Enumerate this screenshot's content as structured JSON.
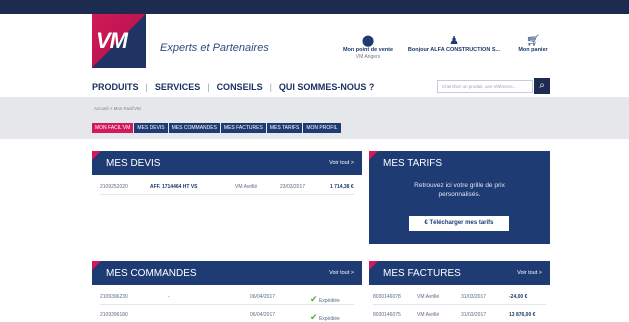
{
  "header": {
    "logo_text": "VM",
    "tagline": "Experts et Partenaires",
    "store_label": "Mon point de vente",
    "store_name": "VM Angers",
    "greeting": "Bonjour ALFA CONSTRUCTION S...",
    "cart_label": "Mon panier"
  },
  "nav": {
    "items": [
      "PRODUITS",
      "SERVICES",
      "CONSEILS",
      "QUI SOMMES-NOUS ?"
    ],
    "search_placeholder": "Cherchez un produit, une référence..."
  },
  "breadcrumb": "Accueil > Mon Facil'VM",
  "tabs": [
    "MON FACIL'VM",
    "MES DEVIS",
    "MES COMMANDES",
    "MES FACTURES",
    "MES TARIFS",
    "MON PROFIL"
  ],
  "devis": {
    "title": "MES DEVIS",
    "see_all": "Voir tout >",
    "rows": [
      {
        "num": "2109252020",
        "ref": "AFF. 1714464 HT VS",
        "agent": "VM Avrillé",
        "date": "23/03/2017",
        "amount": "1 714,38 €"
      }
    ]
  },
  "tarifs": {
    "title": "MES TARIFS",
    "message": "Retrouvez ici votre grille de prix personnalisés.",
    "button": "€ Télécharger mes tarifs"
  },
  "commandes": {
    "title": "MES COMMANDES",
    "see_all": "Voir tout >",
    "rows": [
      {
        "num": "2109396230",
        "ref": "-",
        "date": "06/04/2017",
        "status": "Expédiée"
      },
      {
        "num": "2109396180",
        "ref": "",
        "date": "06/04/2017",
        "status": "Expédiée"
      }
    ]
  },
  "factures": {
    "title": "MES FACTURES",
    "see_all": "Voir tout >",
    "rows": [
      {
        "num": "8030146078",
        "agent": "VM Avrillé",
        "date": "31/03/2017",
        "amount": "-24,00 €"
      },
      {
        "num": "8030146075",
        "agent": "VM Avrillé",
        "date": "31/03/2017",
        "amount": "13 876,00 €"
      }
    ]
  }
}
